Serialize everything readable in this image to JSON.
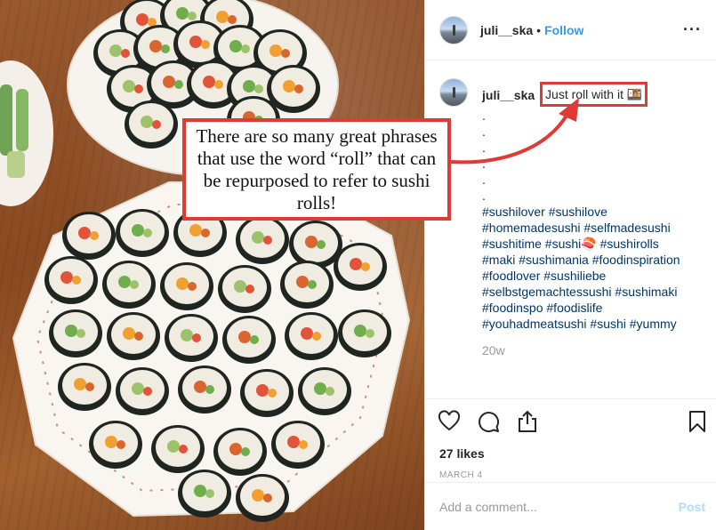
{
  "callout": {
    "text": "There are so many great phrases that use the word “roll” that can be repurposed to refer to sushi rolls!"
  },
  "header": {
    "username": "juli__ska",
    "separator": "•",
    "follow_label": "Follow",
    "more_label": "···"
  },
  "caption": {
    "username": "juli__ska",
    "text": "Just roll with it 🍱",
    "dots": [
      ".",
      ".",
      ".",
      ".",
      ".",
      "."
    ],
    "hashtag_lines": [
      "#sushilover #sushilove",
      "#homemadesushi #selfmadesushi",
      "#sushitime #sushi🍣 #sushirolls",
      "#maki #sushimania #foodinspiration",
      "#foodlover #sushiliebe",
      "#selbstgemachtessushi #sushimaki",
      "#foodinspo #foodislife",
      "#youhadmeatsushi #sushi #yummy"
    ],
    "time_ago": "20w"
  },
  "actions": {
    "icons": [
      "heart-icon",
      "comment-icon",
      "share-icon",
      "bookmark-icon"
    ],
    "likes": "27 likes",
    "date": "MARCH 4"
  },
  "comment": {
    "placeholder": "Add a comment...",
    "post_label": "Post"
  },
  "colors": {
    "annotation_red": "#e03a35",
    "link_blue": "#3897f0",
    "hashtag_blue": "#003569",
    "muted_gray": "#999999"
  }
}
